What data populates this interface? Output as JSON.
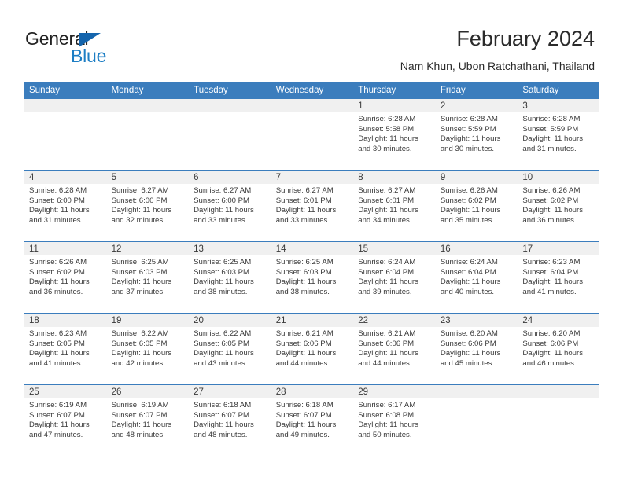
{
  "brand": {
    "name_top": "General",
    "name_bottom": "Blue",
    "triangle_icon": "blue-triangle-icon",
    "accent_color": "#1d7ec4"
  },
  "header": {
    "title": "February 2024",
    "subtitle": "Nam Khun, Ubon Ratchathani, Thailand"
  },
  "calendar": {
    "header_bg": "#3b7dbd",
    "daynum_bg": "#f0f0f0",
    "weekday_headers": [
      "Sunday",
      "Monday",
      "Tuesday",
      "Wednesday",
      "Thursday",
      "Friday",
      "Saturday"
    ],
    "weeks": [
      [
        {
          "day": "",
          "empty": true
        },
        {
          "day": "",
          "empty": true
        },
        {
          "day": "",
          "empty": true
        },
        {
          "day": "",
          "empty": true
        },
        {
          "day": "1",
          "sunrise": "Sunrise: 6:28 AM",
          "sunset": "Sunset: 5:58 PM",
          "daylight1": "Daylight: 11 hours",
          "daylight2": "and 30 minutes."
        },
        {
          "day": "2",
          "sunrise": "Sunrise: 6:28 AM",
          "sunset": "Sunset: 5:59 PM",
          "daylight1": "Daylight: 11 hours",
          "daylight2": "and 30 minutes."
        },
        {
          "day": "3",
          "sunrise": "Sunrise: 6:28 AM",
          "sunset": "Sunset: 5:59 PM",
          "daylight1": "Daylight: 11 hours",
          "daylight2": "and 31 minutes."
        }
      ],
      [
        {
          "day": "4",
          "sunrise": "Sunrise: 6:28 AM",
          "sunset": "Sunset: 6:00 PM",
          "daylight1": "Daylight: 11 hours",
          "daylight2": "and 31 minutes."
        },
        {
          "day": "5",
          "sunrise": "Sunrise: 6:27 AM",
          "sunset": "Sunset: 6:00 PM",
          "daylight1": "Daylight: 11 hours",
          "daylight2": "and 32 minutes."
        },
        {
          "day": "6",
          "sunrise": "Sunrise: 6:27 AM",
          "sunset": "Sunset: 6:00 PM",
          "daylight1": "Daylight: 11 hours",
          "daylight2": "and 33 minutes."
        },
        {
          "day": "7",
          "sunrise": "Sunrise: 6:27 AM",
          "sunset": "Sunset: 6:01 PM",
          "daylight1": "Daylight: 11 hours",
          "daylight2": "and 33 minutes."
        },
        {
          "day": "8",
          "sunrise": "Sunrise: 6:27 AM",
          "sunset": "Sunset: 6:01 PM",
          "daylight1": "Daylight: 11 hours",
          "daylight2": "and 34 minutes."
        },
        {
          "day": "9",
          "sunrise": "Sunrise: 6:26 AM",
          "sunset": "Sunset: 6:02 PM",
          "daylight1": "Daylight: 11 hours",
          "daylight2": "and 35 minutes."
        },
        {
          "day": "10",
          "sunrise": "Sunrise: 6:26 AM",
          "sunset": "Sunset: 6:02 PM",
          "daylight1": "Daylight: 11 hours",
          "daylight2": "and 36 minutes."
        }
      ],
      [
        {
          "day": "11",
          "sunrise": "Sunrise: 6:26 AM",
          "sunset": "Sunset: 6:02 PM",
          "daylight1": "Daylight: 11 hours",
          "daylight2": "and 36 minutes."
        },
        {
          "day": "12",
          "sunrise": "Sunrise: 6:25 AM",
          "sunset": "Sunset: 6:03 PM",
          "daylight1": "Daylight: 11 hours",
          "daylight2": "and 37 minutes."
        },
        {
          "day": "13",
          "sunrise": "Sunrise: 6:25 AM",
          "sunset": "Sunset: 6:03 PM",
          "daylight1": "Daylight: 11 hours",
          "daylight2": "and 38 minutes."
        },
        {
          "day": "14",
          "sunrise": "Sunrise: 6:25 AM",
          "sunset": "Sunset: 6:03 PM",
          "daylight1": "Daylight: 11 hours",
          "daylight2": "and 38 minutes."
        },
        {
          "day": "15",
          "sunrise": "Sunrise: 6:24 AM",
          "sunset": "Sunset: 6:04 PM",
          "daylight1": "Daylight: 11 hours",
          "daylight2": "and 39 minutes."
        },
        {
          "day": "16",
          "sunrise": "Sunrise: 6:24 AM",
          "sunset": "Sunset: 6:04 PM",
          "daylight1": "Daylight: 11 hours",
          "daylight2": "and 40 minutes."
        },
        {
          "day": "17",
          "sunrise": "Sunrise: 6:23 AM",
          "sunset": "Sunset: 6:04 PM",
          "daylight1": "Daylight: 11 hours",
          "daylight2": "and 41 minutes."
        }
      ],
      [
        {
          "day": "18",
          "sunrise": "Sunrise: 6:23 AM",
          "sunset": "Sunset: 6:05 PM",
          "daylight1": "Daylight: 11 hours",
          "daylight2": "and 41 minutes."
        },
        {
          "day": "19",
          "sunrise": "Sunrise: 6:22 AM",
          "sunset": "Sunset: 6:05 PM",
          "daylight1": "Daylight: 11 hours",
          "daylight2": "and 42 minutes."
        },
        {
          "day": "20",
          "sunrise": "Sunrise: 6:22 AM",
          "sunset": "Sunset: 6:05 PM",
          "daylight1": "Daylight: 11 hours",
          "daylight2": "and 43 minutes."
        },
        {
          "day": "21",
          "sunrise": "Sunrise: 6:21 AM",
          "sunset": "Sunset: 6:06 PM",
          "daylight1": "Daylight: 11 hours",
          "daylight2": "and 44 minutes."
        },
        {
          "day": "22",
          "sunrise": "Sunrise: 6:21 AM",
          "sunset": "Sunset: 6:06 PM",
          "daylight1": "Daylight: 11 hours",
          "daylight2": "and 44 minutes."
        },
        {
          "day": "23",
          "sunrise": "Sunrise: 6:20 AM",
          "sunset": "Sunset: 6:06 PM",
          "daylight1": "Daylight: 11 hours",
          "daylight2": "and 45 minutes."
        },
        {
          "day": "24",
          "sunrise": "Sunrise: 6:20 AM",
          "sunset": "Sunset: 6:06 PM",
          "daylight1": "Daylight: 11 hours",
          "daylight2": "and 46 minutes."
        }
      ],
      [
        {
          "day": "25",
          "sunrise": "Sunrise: 6:19 AM",
          "sunset": "Sunset: 6:07 PM",
          "daylight1": "Daylight: 11 hours",
          "daylight2": "and 47 minutes."
        },
        {
          "day": "26",
          "sunrise": "Sunrise: 6:19 AM",
          "sunset": "Sunset: 6:07 PM",
          "daylight1": "Daylight: 11 hours",
          "daylight2": "and 48 minutes."
        },
        {
          "day": "27",
          "sunrise": "Sunrise: 6:18 AM",
          "sunset": "Sunset: 6:07 PM",
          "daylight1": "Daylight: 11 hours",
          "daylight2": "and 48 minutes."
        },
        {
          "day": "28",
          "sunrise": "Sunrise: 6:18 AM",
          "sunset": "Sunset: 6:07 PM",
          "daylight1": "Daylight: 11 hours",
          "daylight2": "and 49 minutes."
        },
        {
          "day": "29",
          "sunrise": "Sunrise: 6:17 AM",
          "sunset": "Sunset: 6:08 PM",
          "daylight1": "Daylight: 11 hours",
          "daylight2": "and 50 minutes."
        },
        {
          "day": "",
          "empty": true
        },
        {
          "day": "",
          "empty": true
        }
      ]
    ]
  }
}
